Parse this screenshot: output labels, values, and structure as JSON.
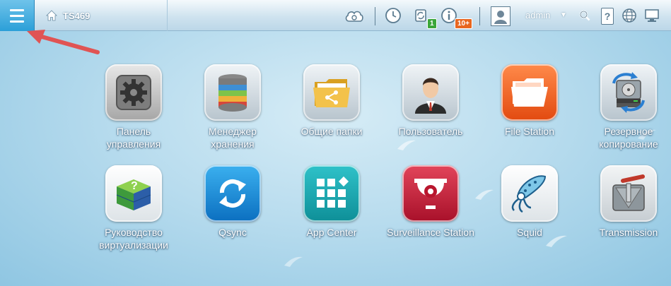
{
  "header": {
    "menu_label": "Main menu",
    "device_name": "TS469",
    "user": "admin",
    "sync_badge": "1",
    "notification_badge": "10+",
    "icons": [
      "menu-icon",
      "home-icon",
      "cloud-icon",
      "clock-icon",
      "sync-icon",
      "info-icon",
      "avatar",
      "search-icon",
      "help-icon",
      "globe-icon",
      "monitor-icon"
    ]
  },
  "apps": [
    {
      "label": "Панель\nуправления",
      "icon": "gear-icon"
    },
    {
      "label": "Менеджер\nхранения",
      "icon": "database-icon"
    },
    {
      "label": "Общие папки",
      "icon": "shared-folder-icon"
    },
    {
      "label": "Пользователь",
      "icon": "user-icon"
    },
    {
      "label": "File Station",
      "icon": "folder-icon"
    },
    {
      "label": "Резервное\nкопирование",
      "icon": "backup-icon"
    },
    {
      "label": "Руководство\nвиртуализации",
      "icon": "virtualization-cube-icon"
    },
    {
      "label": "Qsync",
      "icon": "sync-arrows-icon"
    },
    {
      "label": "App Center",
      "icon": "grid-icon"
    },
    {
      "label": "Surveillance Station",
      "icon": "camera-icon"
    },
    {
      "label": "Squid",
      "icon": "squid-icon"
    },
    {
      "label": "Transmission",
      "icon": "transmission-icon"
    }
  ],
  "colors": {
    "accent": "#2b9fd8",
    "arrow": "#e05454",
    "badge_green": "#3aa63a",
    "badge_orange": "#e8661f"
  }
}
